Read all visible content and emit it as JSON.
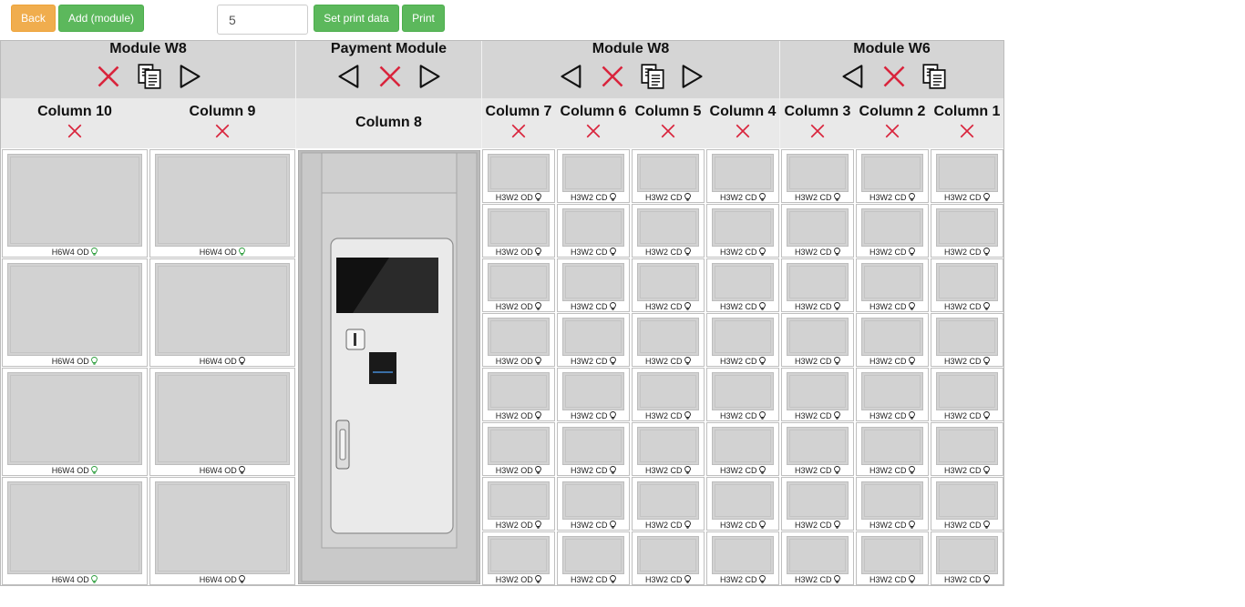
{
  "toolbar": {
    "back_label": "Back",
    "add_module_label": "Add (module)",
    "quantity_value": "5",
    "set_print_data_label": "Set print data",
    "print_label": "Print"
  },
  "modules": [
    {
      "title": "Module W8",
      "icons": [
        "close-icon",
        "copy-icon",
        "arrow-right-icon"
      ]
    },
    {
      "title": "Payment Module",
      "icons": [
        "arrow-left-icon",
        "close-icon",
        "arrow-right-icon"
      ]
    },
    {
      "title": "Module W8",
      "icons": [
        "arrow-left-icon",
        "close-icon",
        "copy-icon",
        "arrow-right-icon"
      ]
    },
    {
      "title": "Module W6",
      "icons": [
        "arrow-left-icon",
        "close-icon",
        "copy-icon"
      ]
    }
  ],
  "columns": [
    {
      "title": "Column 10",
      "removable": true,
      "type": "large",
      "cells": [
        "H6W4 OD",
        "H6W4 OD",
        "H6W4 OD",
        "H6W4 OD"
      ],
      "lit": [
        true,
        true,
        true,
        true
      ]
    },
    {
      "title": "Column 9",
      "removable": true,
      "type": "large",
      "cells": [
        "H6W4 OD",
        "H6W4 OD",
        "H6W4 OD",
        "H6W4 OD"
      ],
      "lit": [
        true,
        false,
        false,
        false
      ]
    },
    {
      "title": "Column 8",
      "removable": false,
      "type": "payment"
    },
    {
      "title": "Column 7",
      "removable": true,
      "type": "small",
      "cells": [
        "H3W2 OD",
        "H3W2 OD",
        "H3W2 OD",
        "H3W2 OD",
        "H3W2 OD",
        "H3W2 OD",
        "H3W2 OD",
        "H3W2 OD"
      ]
    },
    {
      "title": "Column 6",
      "removable": true,
      "type": "small",
      "cells": [
        "H3W2 CD",
        "H3W2 CD",
        "H3W2 CD",
        "H3W2 CD",
        "H3W2 CD",
        "H3W2 CD",
        "H3W2 CD",
        "H3W2 CD"
      ]
    },
    {
      "title": "Column 5",
      "removable": true,
      "type": "small",
      "cells": [
        "H3W2 CD",
        "H3W2 CD",
        "H3W2 CD",
        "H3W2 CD",
        "H3W2 CD",
        "H3W2 CD",
        "H3W2 CD",
        "H3W2 CD"
      ]
    },
    {
      "title": "Column 4",
      "removable": true,
      "type": "small",
      "cells": [
        "H3W2 CD",
        "H3W2 CD",
        "H3W2 CD",
        "H3W2 CD",
        "H3W2 CD",
        "H3W2 CD",
        "H3W2 CD",
        "H3W2 CD"
      ]
    },
    {
      "title": "Column 3",
      "removable": true,
      "type": "small",
      "cells": [
        "H3W2 CD",
        "H3W2 CD",
        "H3W2 CD",
        "H3W2 CD",
        "H3W2 CD",
        "H3W2 CD",
        "H3W2 CD",
        "H3W2 CD"
      ]
    },
    {
      "title": "Column 2",
      "removable": true,
      "type": "small",
      "cells": [
        "H3W2 CD",
        "H3W2 CD",
        "H3W2 CD",
        "H3W2 CD",
        "H3W2 CD",
        "H3W2 CD",
        "H3W2 CD",
        "H3W2 CD"
      ]
    },
    {
      "title": "Column 1",
      "removable": true,
      "type": "small",
      "cells": [
        "H3W2 CD",
        "H3W2 CD",
        "H3W2 CD",
        "H3W2 CD",
        "H3W2 CD",
        "H3W2 CD",
        "H3W2 CD",
        "H3W2 CD"
      ]
    }
  ],
  "colors": {
    "back": "#f0ad4e",
    "success": "#5cb85c",
    "remove": "#d9243c",
    "light_bulb": "#2e9e3e"
  }
}
